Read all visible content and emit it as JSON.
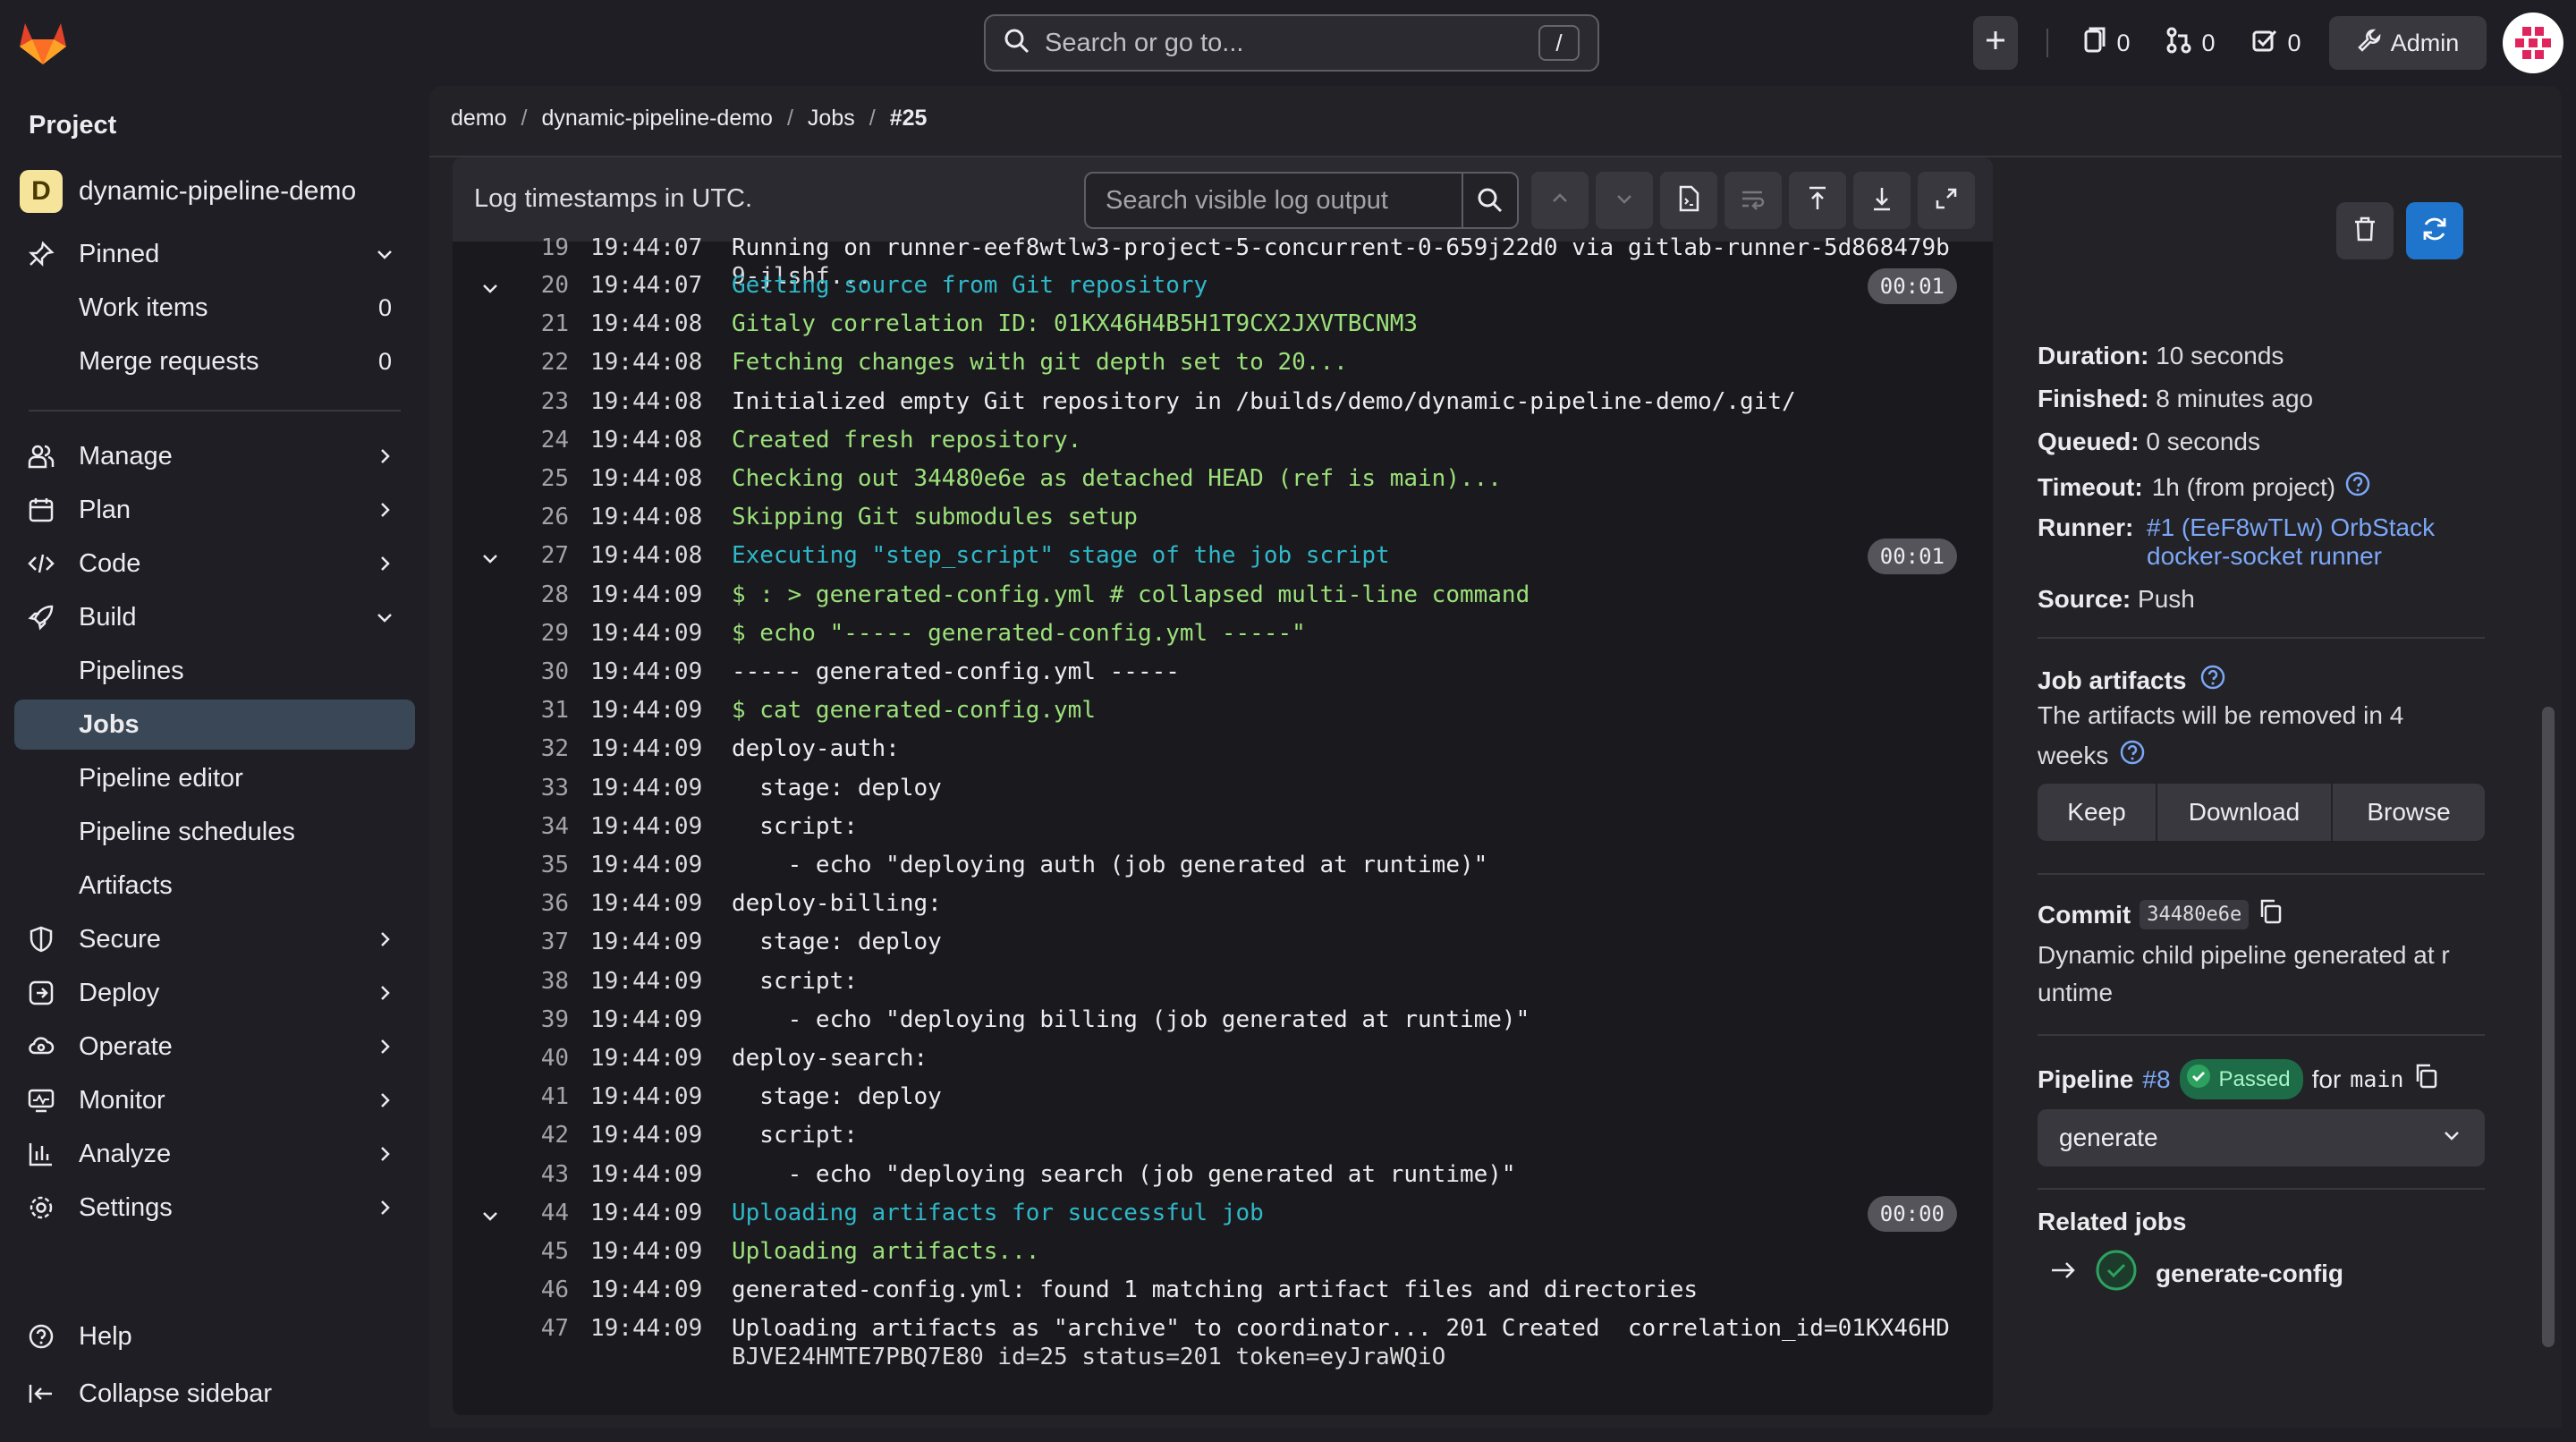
{
  "topbar": {
    "search_placeholder": "Search or go to...",
    "search_shortcut": "/",
    "issues_count": "0",
    "merge_requests_count": "0",
    "todos_count": "0",
    "admin_label": "Admin"
  },
  "sidebar": {
    "section_title": "Project",
    "project_initial": "D",
    "project_name": "dynamic-pipeline-demo",
    "pinned": {
      "label": "Pinned",
      "items": [
        {
          "label": "Work items",
          "count": "0"
        },
        {
          "label": "Merge requests",
          "count": "0"
        }
      ]
    },
    "items": {
      "manage": "Manage",
      "plan": "Plan",
      "code": "Code",
      "build": "Build",
      "pipelines": "Pipelines",
      "jobs": "Jobs",
      "pipeline_editor": "Pipeline editor",
      "pipeline_schedules": "Pipeline schedules",
      "artifacts": "Artifacts",
      "secure": "Secure",
      "deploy": "Deploy",
      "operate": "Operate",
      "monitor": "Monitor",
      "analyze": "Analyze",
      "settings": "Settings"
    },
    "help": "Help",
    "collapse": "Collapse sidebar"
  },
  "breadcrumb": [
    "demo",
    "dynamic-pipeline-demo",
    "Jobs",
    "#25"
  ],
  "log": {
    "timestamps_note": "Log timestamps in UTC.",
    "search_placeholder": "Search visible log output",
    "lines": [
      {
        "num": "19",
        "time": "19:44:07",
        "text": "Running on runner-eef8wtlw3-project-5-concurrent-0-659j22d0 via gitlab-runner-5d868479b",
        "cont": "9-jlshf...",
        "color": "white"
      },
      {
        "num": "20",
        "time": "19:44:07",
        "text": "Getting source from Git repository",
        "color": "cyan",
        "section": true,
        "duration": "00:01"
      },
      {
        "num": "21",
        "time": "19:44:08",
        "text": "Gitaly correlation ID: 01KX46H4B5H1T9CX2JXVTBCNM3",
        "color": "green"
      },
      {
        "num": "22",
        "time": "19:44:08",
        "text": "Fetching changes with git depth set to 20...",
        "color": "green"
      },
      {
        "num": "23",
        "time": "19:44:08",
        "text": "Initialized empty Git repository in /builds/demo/dynamic-pipeline-demo/.git/",
        "color": "white"
      },
      {
        "num": "24",
        "time": "19:44:08",
        "text": "Created fresh repository.",
        "color": "green"
      },
      {
        "num": "25",
        "time": "19:44:08",
        "text": "Checking out 34480e6e as detached HEAD (ref is main)...",
        "color": "green"
      },
      {
        "num": "26",
        "time": "19:44:08",
        "text": "Skipping Git submodules setup",
        "color": "green"
      },
      {
        "num": "27",
        "time": "19:44:08",
        "text": "Executing \"step_script\" stage of the job script",
        "color": "cyan",
        "section": true,
        "duration": "00:01"
      },
      {
        "num": "28",
        "time": "19:44:09",
        "text": "$ : > generated-config.yml # collapsed multi-line command",
        "color": "green"
      },
      {
        "num": "29",
        "time": "19:44:09",
        "text": "$ echo \"----- generated-config.yml -----\"",
        "color": "green"
      },
      {
        "num": "30",
        "time": "19:44:09",
        "text": "----- generated-config.yml -----",
        "color": "white"
      },
      {
        "num": "31",
        "time": "19:44:09",
        "text": "$ cat generated-config.yml",
        "color": "green"
      },
      {
        "num": "32",
        "time": "19:44:09",
        "text": "deploy-auth:",
        "color": "white"
      },
      {
        "num": "33",
        "time": "19:44:09",
        "text": "  stage: deploy",
        "color": "white"
      },
      {
        "num": "34",
        "time": "19:44:09",
        "text": "  script:",
        "color": "white"
      },
      {
        "num": "35",
        "time": "19:44:09",
        "text": "    - echo \"deploying auth (job generated at runtime)\"",
        "color": "white"
      },
      {
        "num": "36",
        "time": "19:44:09",
        "text": "deploy-billing:",
        "color": "white"
      },
      {
        "num": "37",
        "time": "19:44:09",
        "text": "  stage: deploy",
        "color": "white"
      },
      {
        "num": "38",
        "time": "19:44:09",
        "text": "  script:",
        "color": "white"
      },
      {
        "num": "39",
        "time": "19:44:09",
        "text": "    - echo \"deploying billing (job generated at runtime)\"",
        "color": "white"
      },
      {
        "num": "40",
        "time": "19:44:09",
        "text": "deploy-search:",
        "color": "white"
      },
      {
        "num": "41",
        "time": "19:44:09",
        "text": "  stage: deploy",
        "color": "white"
      },
      {
        "num": "42",
        "time": "19:44:09",
        "text": "  script:",
        "color": "white"
      },
      {
        "num": "43",
        "time": "19:44:09",
        "text": "    - echo \"deploying search (job generated at runtime)\"",
        "color": "white"
      },
      {
        "num": "44",
        "time": "19:44:09",
        "text": "Uploading artifacts for successful job",
        "color": "cyan",
        "section": true,
        "duration": "00:00"
      },
      {
        "num": "45",
        "time": "19:44:09",
        "text": "Uploading artifacts...",
        "color": "green"
      },
      {
        "num": "46",
        "time": "19:44:09",
        "text": "generated-config.yml: found 1 matching artifact files and directories",
        "color": "white"
      },
      {
        "num": "47",
        "time": "19:44:09",
        "text": "Uploading artifacts as \"archive\" to coordinator... 201 Created  correlation_id=01KX46HD",
        "cont": "BJVE24HMTE7PBQ7E80 id=25 status=201 token=eyJraWQiO",
        "color": "white"
      }
    ]
  },
  "details": {
    "duration_label": "Duration:",
    "duration": "10 seconds",
    "finished_label": "Finished:",
    "finished": "8 minutes ago",
    "queued_label": "Queued:",
    "queued": "0 seconds",
    "timeout_label": "Timeout:",
    "timeout": "1h (from project)",
    "runner_label": "Runner:",
    "runner_line1": "#1 (EeF8wTLw) OrbStack",
    "runner_line2": "docker-socket runner",
    "source_label": "Source:",
    "source": "Push",
    "artifacts_title": "Job artifacts",
    "artifacts_note_1": "The artifacts will be removed in 4",
    "artifacts_note_2": "weeks",
    "keep": "Keep",
    "download": "Download",
    "browse": "Browse",
    "commit_label": "Commit",
    "commit_sha": "34480e6e",
    "commit_msg_1": "Dynamic child pipeline generated at r",
    "commit_msg_2": "untime",
    "pipeline_label": "Pipeline",
    "pipeline_id": "#8",
    "pipeline_status": "Passed",
    "pipeline_for": "for",
    "pipeline_ref": "main",
    "stage_select": "generate",
    "related_jobs_title": "Related jobs",
    "related_job": "generate-config"
  },
  "colors": {
    "accent": "#1f75cb",
    "link": "#7ba7f5",
    "success": "#2da160",
    "log_cyan": "#2fb8c9",
    "log_green": "#9ce07a"
  }
}
